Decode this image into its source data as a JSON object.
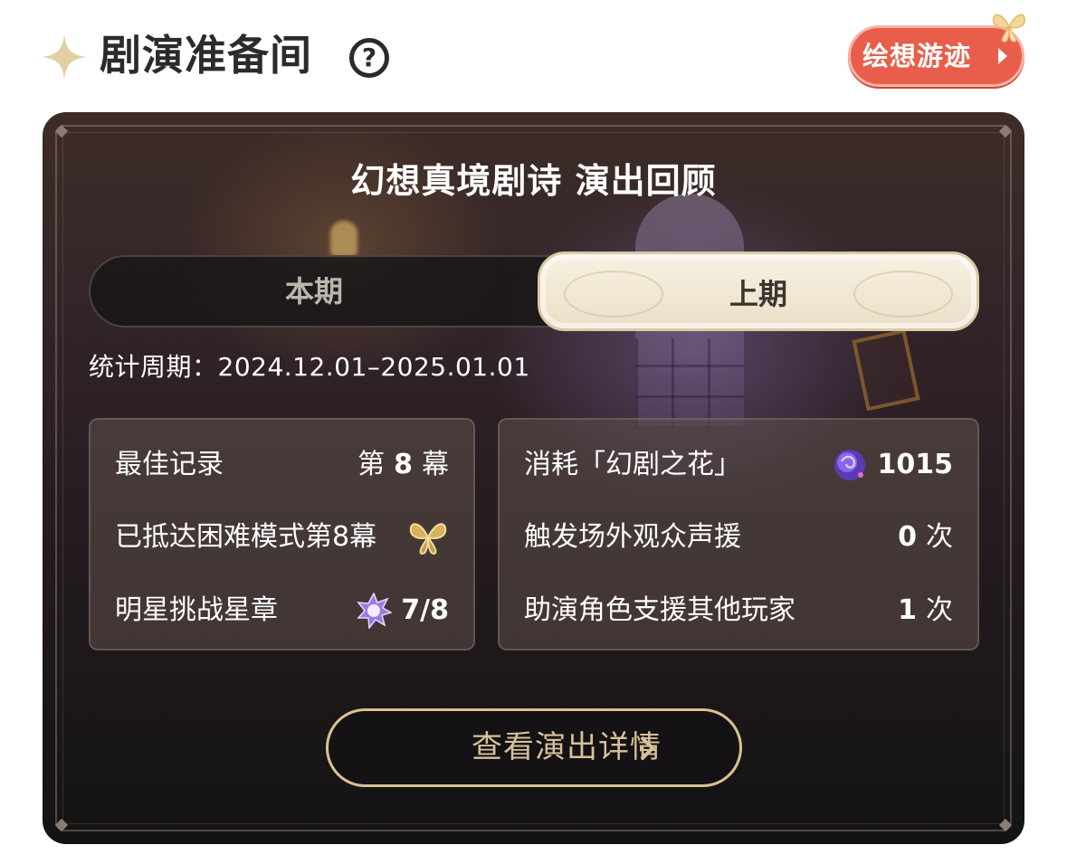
{
  "header": {
    "title": "剧演准备间",
    "help_icon": "?",
    "tag_label": "绘想游迹",
    "icons": [
      "sparkle-star-icon",
      "question-circle-icon",
      "chevron-right-icon",
      "butterfly-icon"
    ]
  },
  "card": {
    "title": "幻想真境剧诗 演出回顾",
    "tabs": [
      {
        "label": "本期",
        "selected": false
      },
      {
        "label": "上期",
        "selected": true
      }
    ],
    "period_label": "统计周期：",
    "period_range": "2024.12.01–2025.01.01",
    "left_stats": [
      {
        "label": "最佳记录",
        "prefix": "第",
        "value": "8",
        "suffix": "幕"
      },
      {
        "label": "已抵达困难模式第8幕",
        "icon": "gold-butterfly-icon"
      },
      {
        "label": "明星挑战星章",
        "icon": "star-badge-icon",
        "value": "7/8"
      }
    ],
    "right_stats": [
      {
        "label": "消耗「幻剧之花」",
        "icon": "purple-rose-icon",
        "value": "1015"
      },
      {
        "label": "触发场外观众声援",
        "value": "0",
        "suffix": "次"
      },
      {
        "label": "助演角色支援其他玩家",
        "value": "1",
        "suffix": "次"
      }
    ],
    "detail_button": "查看演出详情"
  },
  "colors": {
    "tag_bg": "#e85e4a",
    "card_dark": "#231b1e",
    "gold_text": "#d7c199",
    "selected_tab": "#f8f1e2"
  }
}
